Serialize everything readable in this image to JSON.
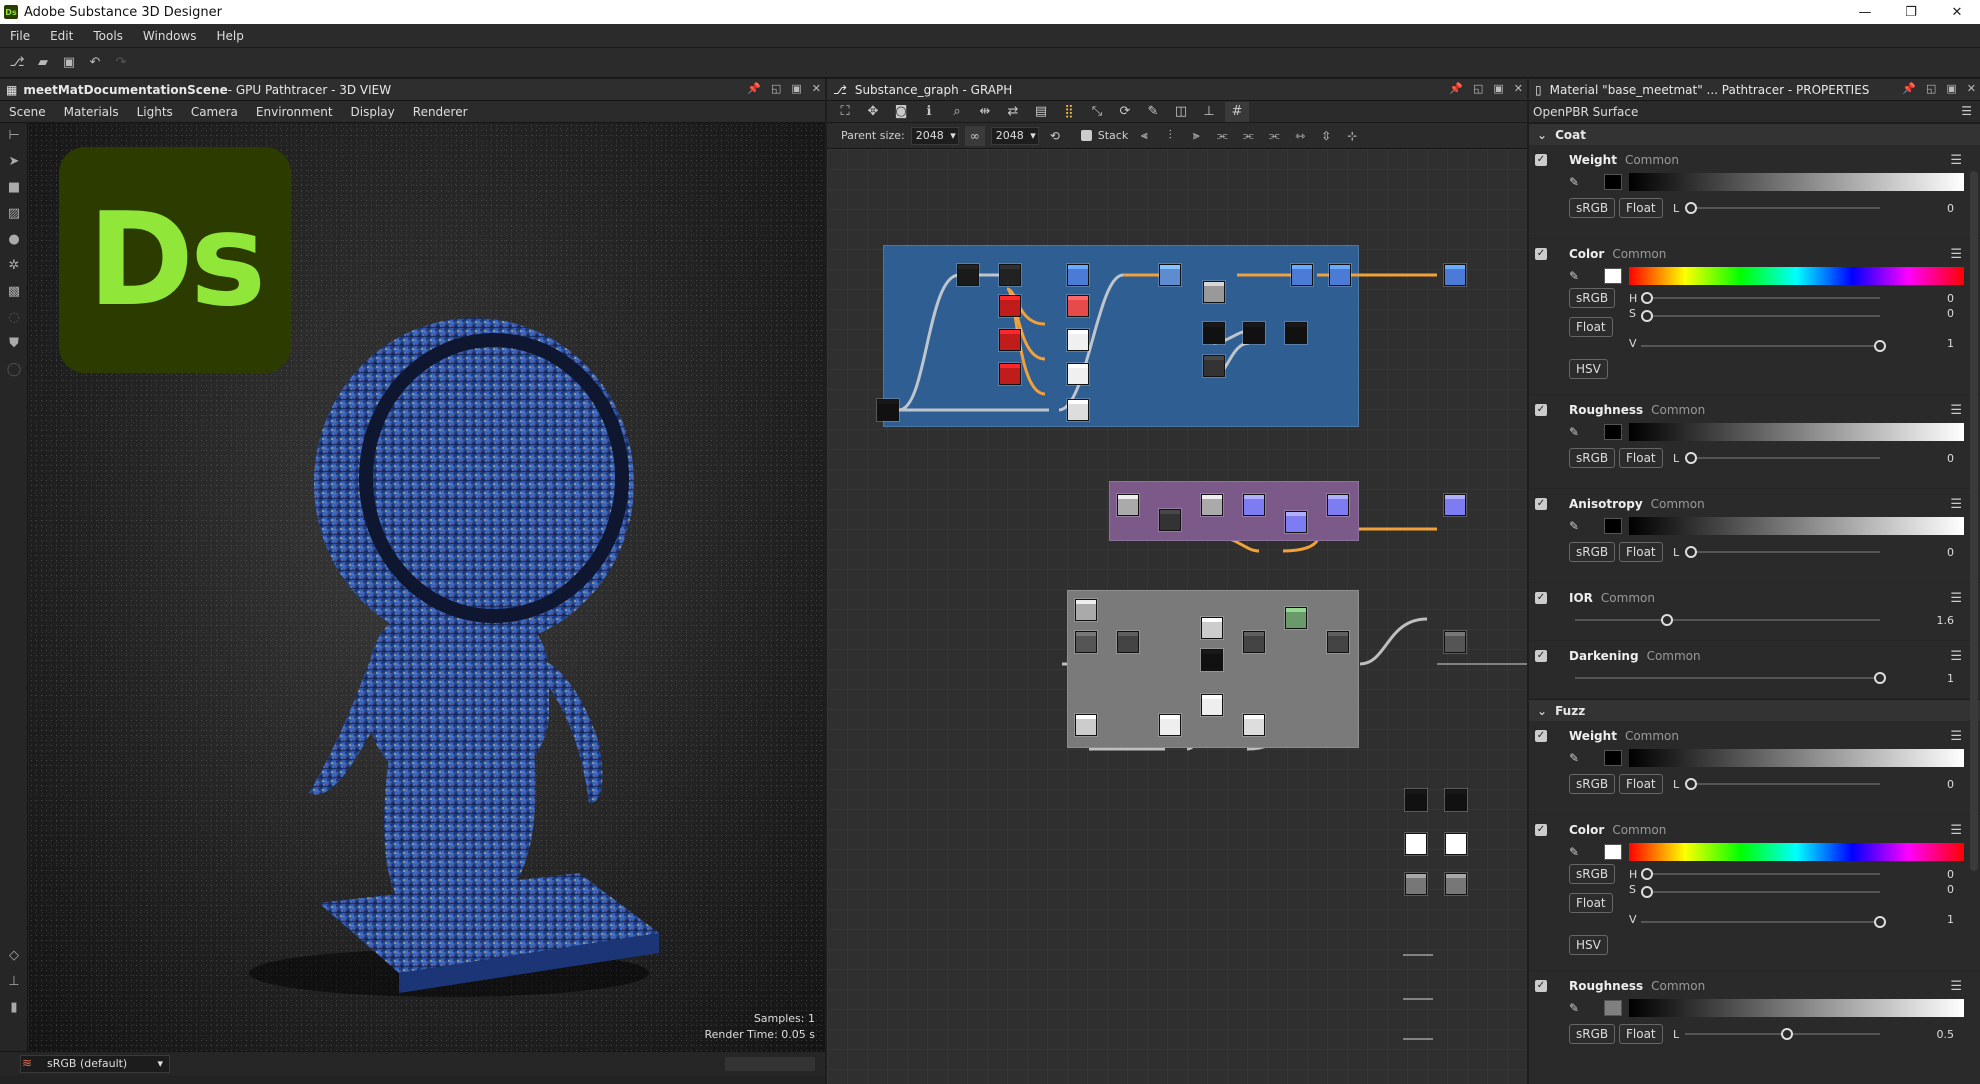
{
  "window": {
    "title": "Adobe Substance 3D Designer",
    "app_icon": "Ds"
  },
  "menu": [
    "File",
    "Edit",
    "Tools",
    "Windows",
    "Help"
  ],
  "view3d": {
    "title_bold": "meetMatDocumentationScene",
    "title_rest": " - GPU Pathtracer - 3D VIEW",
    "menu": [
      "Scene",
      "Materials",
      "Lights",
      "Camera",
      "Environment",
      "Display",
      "Renderer"
    ],
    "logo_text": "Ds",
    "samples": "Samples: 1",
    "render_time": "Render Time: 0.05 s",
    "colorspace": "sRGB (default)"
  },
  "graph": {
    "title": "Substance_graph - GRAPH",
    "parent_size_label": "Parent size:",
    "size_a": "2048",
    "size_b": "2048",
    "stack_label": "Stack"
  },
  "props": {
    "title": "Material \"base_meetmat\" ... Pathtracer - PROPERTIES",
    "shader": "OpenPBR Surface",
    "sections": {
      "coat": "Coat",
      "fuzz": "Fuzz"
    },
    "common": "Common",
    "coat_weight": {
      "name": "Weight",
      "value": "0"
    },
    "coat_color": {
      "name": "Color",
      "h": "0",
      "s": "0",
      "v": "1"
    },
    "coat_roughness": {
      "name": "Roughness",
      "value": "0"
    },
    "coat_anisotropy": {
      "name": "Anisotropy",
      "value": "0"
    },
    "coat_ior": {
      "name": "IOR",
      "value": "1.6"
    },
    "coat_darkening": {
      "name": "Darkening",
      "value": "1"
    },
    "fuzz_weight": {
      "name": "Weight",
      "value": "0"
    },
    "fuzz_color": {
      "name": "Color",
      "h": "0",
      "s": "0",
      "v": "1"
    },
    "fuzz_roughness": {
      "name": "Roughness",
      "value": "0.5"
    },
    "btn_srgb": "sRGB",
    "btn_float": "Float",
    "btn_hsv": "HSV",
    "lbl_l": "L",
    "lbl_h": "H",
    "lbl_s": "S",
    "lbl_v": "V"
  },
  "colors": {
    "accent": "#90e639",
    "logo_bg": "#2c3b00",
    "frame_blue": "#2f5e92",
    "frame_purple": "#7b5a8a",
    "frame_grey": "#7a7a7a"
  }
}
